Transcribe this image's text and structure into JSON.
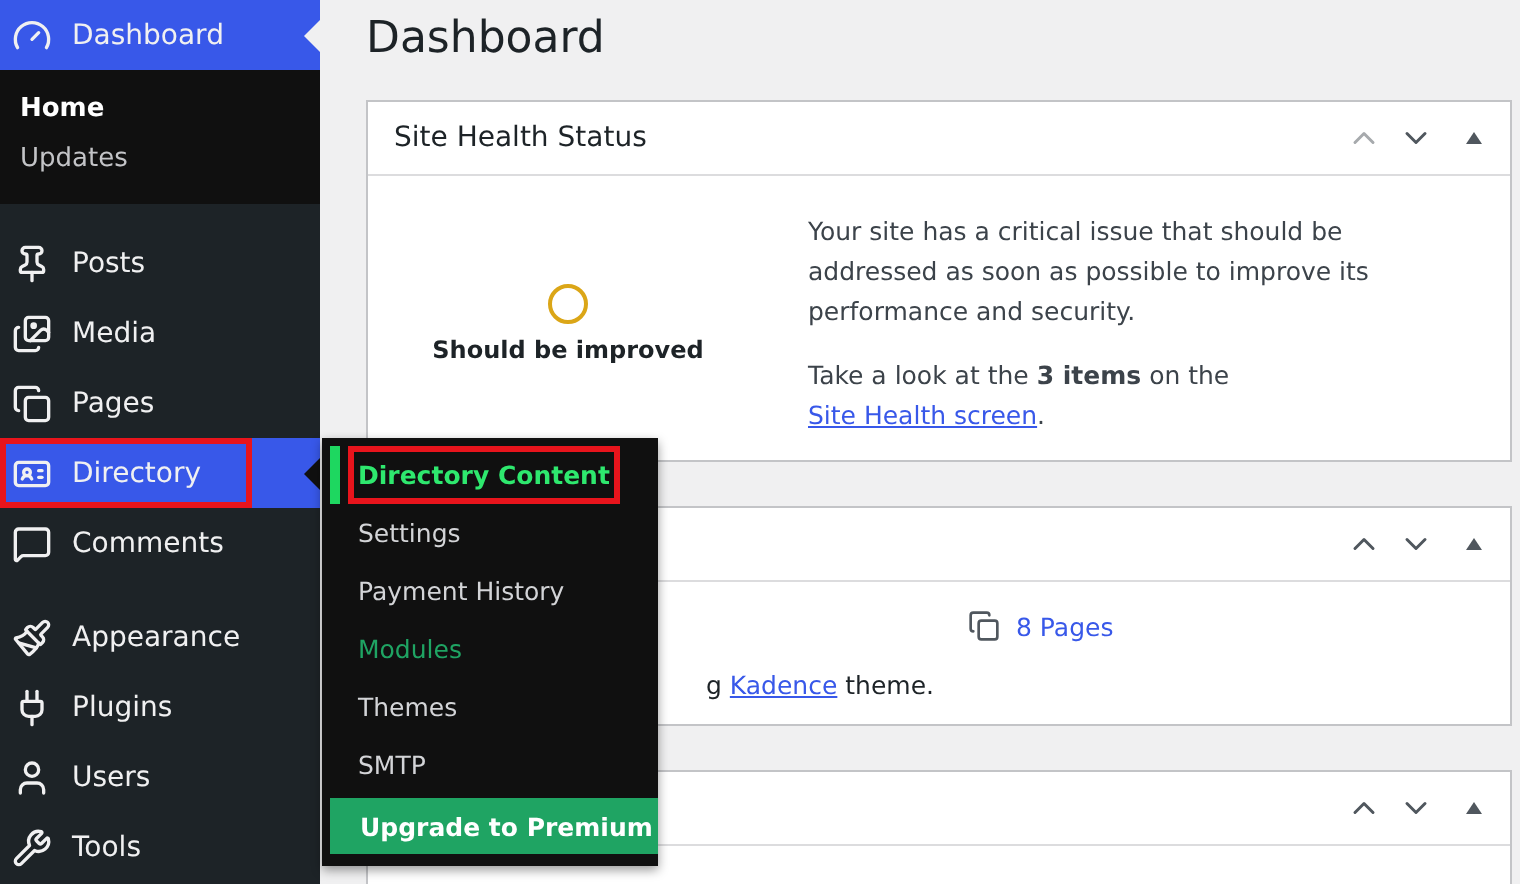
{
  "sidebar": {
    "items": [
      {
        "label": "Dashboard",
        "current": true,
        "flyout_open": false,
        "outlined": false,
        "children": [
          {
            "label": "Home",
            "selected": true
          },
          {
            "label": "Updates",
            "selected": false
          }
        ]
      },
      {
        "label": "Posts",
        "current": false,
        "flyout_open": false,
        "outlined": false
      },
      {
        "label": "Media",
        "current": false,
        "flyout_open": false,
        "outlined": false
      },
      {
        "label": "Pages",
        "current": false,
        "flyout_open": false,
        "outlined": false
      },
      {
        "label": "Directory",
        "current": false,
        "flyout_open": true,
        "outlined": true
      },
      {
        "label": "Comments",
        "current": false,
        "flyout_open": false,
        "outlined": false
      },
      {
        "label": "Appearance",
        "current": false,
        "flyout_open": false,
        "outlined": false
      },
      {
        "label": "Plugins",
        "current": false,
        "flyout_open": false,
        "outlined": false
      },
      {
        "label": "Users",
        "current": false,
        "flyout_open": false,
        "outlined": false
      },
      {
        "label": "Tools",
        "current": false,
        "flyout_open": false,
        "outlined": false
      }
    ]
  },
  "flyout": {
    "items": [
      {
        "label": "Directory Content",
        "kind": "link",
        "selected": true,
        "highlighted": false,
        "outlined": true
      },
      {
        "label": "Settings",
        "kind": "link",
        "selected": false,
        "highlighted": false,
        "outlined": false
      },
      {
        "label": "Payment History",
        "kind": "link",
        "selected": false,
        "highlighted": false,
        "outlined": false
      },
      {
        "label": "Modules",
        "kind": "link",
        "selected": false,
        "highlighted": true,
        "outlined": false
      },
      {
        "label": "Themes",
        "kind": "link",
        "selected": false,
        "highlighted": false,
        "outlined": false
      },
      {
        "label": "SMTP",
        "kind": "link",
        "selected": false,
        "highlighted": false,
        "outlined": false
      },
      {
        "label": "Upgrade to Premium",
        "kind": "upgrade"
      }
    ]
  },
  "page_title": "Dashboard",
  "widgets": [
    {
      "kind": "health",
      "title": "Site Health Status",
      "can_move_up": false,
      "status": "Should be improved",
      "description": "Your site has a critical issue that should be addressed as soon as possible to improve its performance and security.",
      "action": {
        "prefix": "Take a look at the **3 items** on the ",
        "link": "Site Health screen",
        "suffix": "."
      }
    },
    {
      "kind": "glance",
      "can_move_up": true,
      "count_link": "8 Pages",
      "theme_line": {
        "prefix": "g ",
        "link": "Kadence",
        "suffix": " theme."
      }
    },
    {
      "kind": "empty",
      "can_move_up": true
    }
  ]
}
